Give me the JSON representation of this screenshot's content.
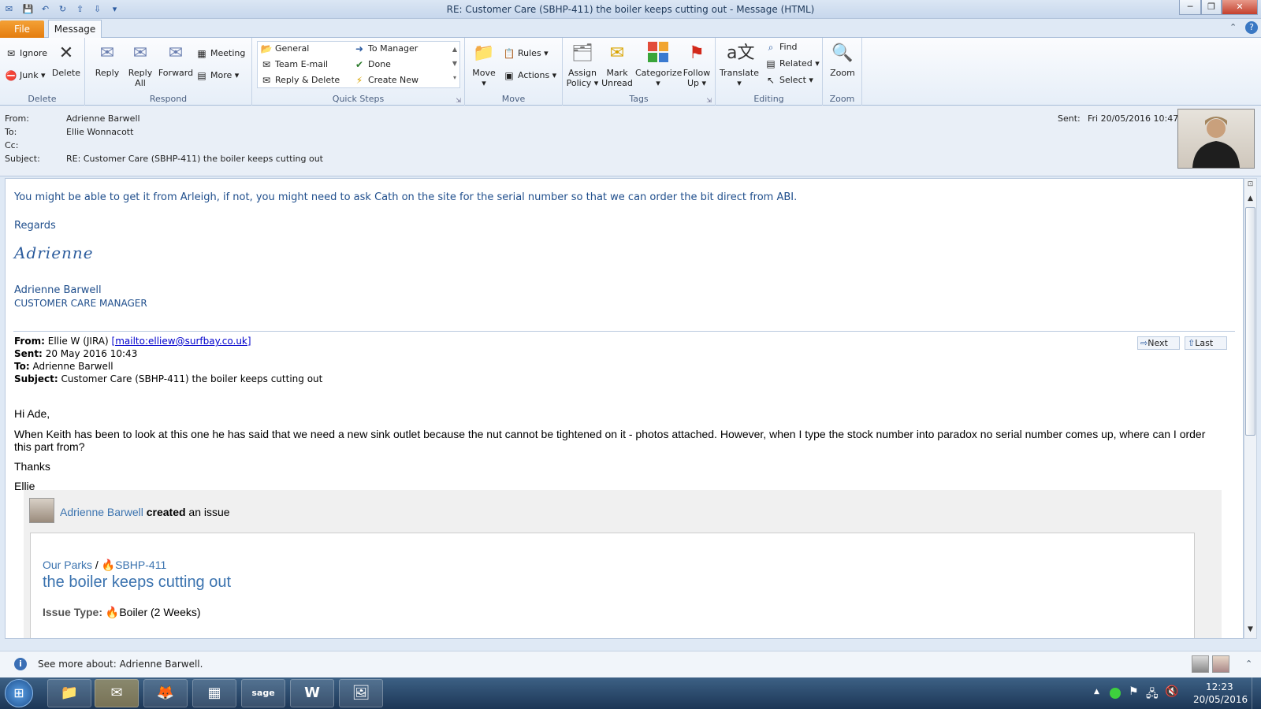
{
  "window": {
    "title": "RE: Customer Care (SBHP-411) the boiler keeps cutting out  -  Message (HTML)",
    "controls": [
      "─",
      "❐",
      "✕"
    ]
  },
  "tabs": {
    "file": "File",
    "message": "Message"
  },
  "ribbon": {
    "delete": {
      "ignore": "Ignore",
      "junk": "Junk",
      "delete": "Delete",
      "label": "Delete"
    },
    "respond": {
      "reply": "Reply",
      "reply_all_1": "Reply",
      "reply_all_2": "All",
      "forward": "Forward",
      "meeting": "Meeting",
      "more": "More",
      "label": "Respond"
    },
    "quick_steps": {
      "items": [
        "General",
        "To Manager",
        "Team E-mail",
        "Done",
        "Reply & Delete",
        "Create New"
      ],
      "label": "Quick Steps"
    },
    "move": {
      "move": "Move",
      "rules": "Rules",
      "actions": "Actions",
      "label": "Move"
    },
    "tags": {
      "assign_1": "Assign",
      "assign_2": "Policy",
      "mark_1": "Mark",
      "mark_2": "Unread",
      "categorize": "Categorize",
      "follow_1": "Follow",
      "follow_2": "Up",
      "label": "Tags"
    },
    "editing": {
      "translate": "Translate",
      "find": "Find",
      "related": "Related",
      "select": "Select",
      "label": "Editing"
    },
    "zoom": {
      "zoom": "Zoom",
      "label": "Zoom"
    }
  },
  "header": {
    "from_label": "From:",
    "from": "Adrienne Barwell",
    "to_label": "To:",
    "to": "Ellie Wonnacott",
    "cc_label": "Cc:",
    "subject_label": "Subject:",
    "subject": "RE: Customer Care (SBHP-411) the boiler keeps cutting out",
    "sent_label": "Sent:",
    "sent": "Fri 20/05/2016 10:47"
  },
  "body": {
    "line1": "You might be able to get it from Arleigh, if not, you might need to ask Cath on the site for the serial number so that we can order the bit direct from ABI.",
    "regards": "Regards",
    "signature": "Adrienne",
    "sig_name": "Adrienne Barwell",
    "sig_title": "CUSTOMER CARE MANAGER",
    "orig_from_label": "From:",
    "orig_from": "Ellie W (JIRA) ",
    "orig_from_link": "[mailto:elliew@surfbay.co.uk]",
    "orig_sent_label": "Sent:",
    "orig_sent": "20 May 2016 10:43",
    "orig_to_label": "To:",
    "orig_to": "Adrienne Barwell",
    "orig_subject_label": "Subject:",
    "orig_subject": "Customer Care (SBHP-411) the boiler keeps cutting out",
    "next": "Next",
    "last": "Last",
    "greeting": "Hi Ade,",
    "para": "When Keith has been to look at this one he has said that we need a new sink outlet because the nut cannot be tightened on it - photos attached. However, when I type the stock number into paradox no serial number comes up, where can I order this part from?",
    "thanks": "Thanks",
    "name": "Ellie",
    "jira_user": "Adrienne Barwell",
    "jira_action": "created",
    "jira_rest": " an issue",
    "project": "Our Parks",
    "sep": "/",
    "issue_key": "SBHP-411",
    "issue_title": "the boiler keeps cutting out",
    "issue_type_label": "Issue Type:",
    "issue_type": "Boiler (2 Weeks)"
  },
  "infobar": {
    "text": "See more about: Adrienne Barwell."
  },
  "taskbar": {
    "time": "12:23",
    "date": "20/05/2016"
  },
  "colors": {
    "accent": "#1f4e8c",
    "file_tab": "#e47d0f",
    "link": "#3b73af"
  }
}
